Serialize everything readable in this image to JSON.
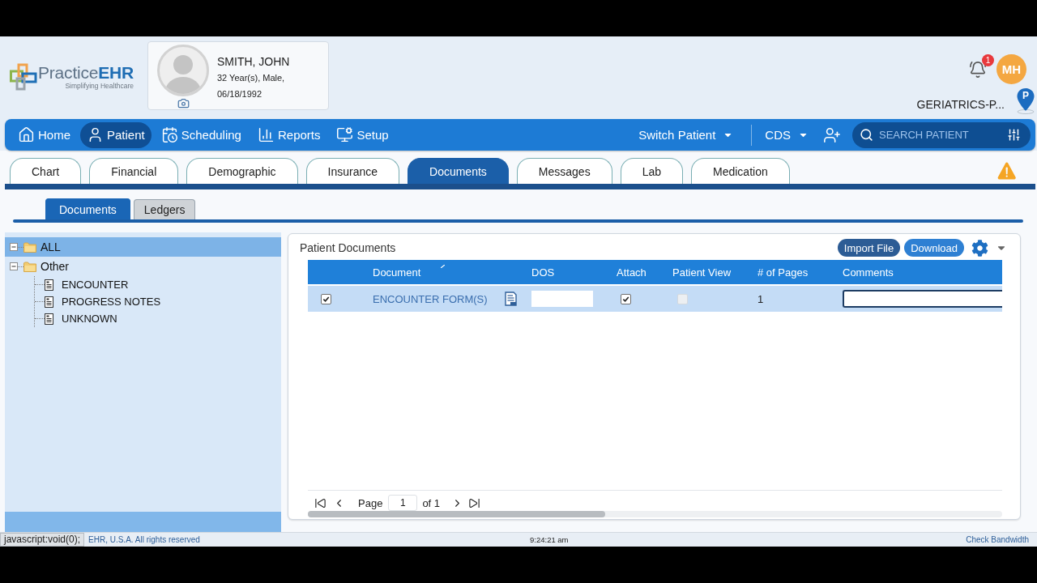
{
  "header": {
    "logo": {
      "name": "Practice**EHR**",
      "tagline": "Simplifying Healthcare"
    },
    "patient": {
      "name": "SMITH, JOHN",
      "summary": "32 Year(s), Male,",
      "dob": "06/18/1992"
    },
    "notifications": {
      "count": "1"
    },
    "user": {
      "initials": "MH"
    },
    "location": {
      "name": "GERIATRICS-P...",
      "pin_label": "P"
    }
  },
  "nav": {
    "items": [
      {
        "label": "Home",
        "selected": false
      },
      {
        "label": "Patient",
        "selected": true
      },
      {
        "label": "Scheduling",
        "selected": false
      },
      {
        "label": "Reports",
        "selected": false
      },
      {
        "label": "Setup",
        "selected": false
      }
    ],
    "switch_patient": "Switch Patient",
    "cds": "CDS",
    "search": {
      "placeholder": "SEARCH PATIENT"
    }
  },
  "tabs": [
    {
      "label": "Chart",
      "selected": false
    },
    {
      "label": "Financial",
      "selected": false
    },
    {
      "label": "Demographic",
      "selected": false
    },
    {
      "label": "Insurance",
      "selected": false
    },
    {
      "label": "Documents",
      "selected": true
    },
    {
      "label": "Messages",
      "selected": false
    },
    {
      "label": "Lab",
      "selected": false
    },
    {
      "label": "Medication",
      "selected": false
    }
  ],
  "subtabs": [
    {
      "label": "Documents",
      "selected": true
    },
    {
      "label": "Ledgers",
      "selected": false
    }
  ],
  "tree": [
    {
      "label": "ALL",
      "kind": "folder",
      "expanded": true,
      "selected": true
    },
    {
      "label": "Other",
      "kind": "folder",
      "expanded": true,
      "selected": false,
      "children": [
        {
          "label": "ENCOUNTER",
          "kind": "document",
          "selected": false
        },
        {
          "label": "PROGRESS NOTES",
          "kind": "document",
          "selected": false
        },
        {
          "label": "UNKNOWN",
          "kind": "document",
          "selected": false
        }
      ]
    }
  ],
  "documents": {
    "title": "Patient Documents",
    "buttons": [
      {
        "label": "Import File",
        "hovered": true
      },
      {
        "label": "Download",
        "hovered": false
      }
    ],
    "table": {
      "columns": [
        "Document",
        "DOS",
        "Attach",
        "Patient View",
        "# of Pages",
        "Comments"
      ],
      "rows": [
        {
          "selected": true,
          "checked": true,
          "document": "ENCOUNTER FORM(S)",
          "attach": true,
          "patient_view": false,
          "patient_view_disabled": true,
          "pages": "1",
          "comments_focused": true
        }
      ]
    },
    "pager": {
      "label": "Page",
      "page": "1",
      "of": "of 1"
    }
  },
  "status_bar": {
    "link_preview": "javascript:void(0);",
    "copyright": "EHR, U.S.A. All rights reserved",
    "time": "9:24:21 am",
    "bandwidth_link": "Check Bandwidth"
  }
}
